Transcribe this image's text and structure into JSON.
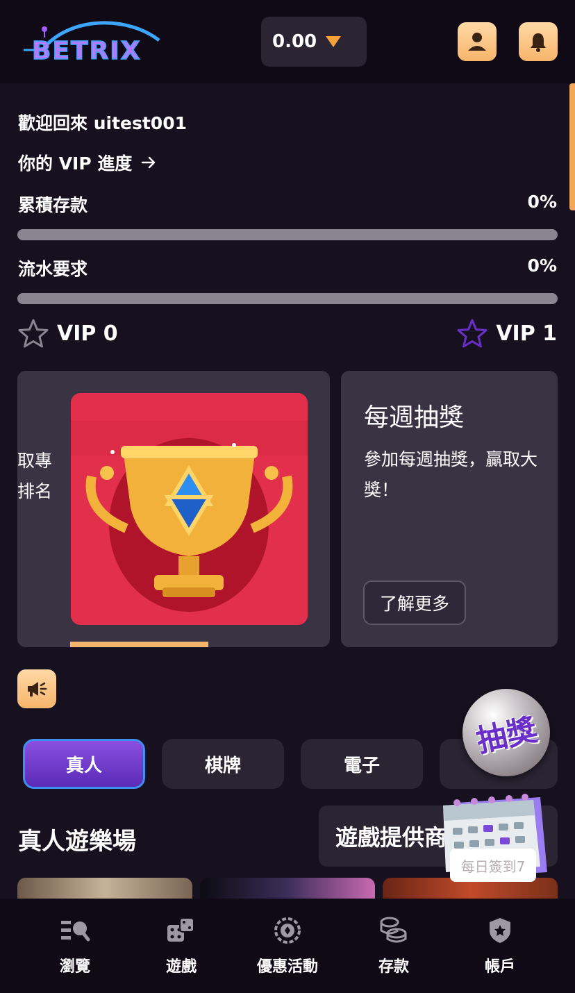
{
  "header": {
    "logo_text": "BETRIX",
    "balance": "0.00",
    "user_icon": "user-icon",
    "bell_icon": "bell-icon"
  },
  "welcome": {
    "greeting": "歡迎回來 uitest001",
    "vip_progress_link": "你的 VIP 進度"
  },
  "progress": {
    "deposit_label": "累積存款",
    "deposit_pct": "0%",
    "deposit_value": 0,
    "turnover_label": "流水要求",
    "turnover_pct": "0%",
    "turnover_value": 0
  },
  "vip": {
    "current": "VIP 0",
    "next": "VIP 1",
    "current_star_color": "#8a8590",
    "next_star_color": "#6a2fc9"
  },
  "promos": {
    "card_a_text_line1": "取專",
    "card_a_text_line2": "排名",
    "card_b_title": "每週抽獎",
    "card_b_desc": "參加每週抽獎，贏取大獎！",
    "card_b_button": "了解更多"
  },
  "categories": {
    "tabs": [
      "真人",
      "棋牌",
      "電子",
      ""
    ],
    "active_index": 0
  },
  "section": {
    "title": "真人遊樂場",
    "provider_button": "遊戲提供商"
  },
  "floating": {
    "lottery_label": "抽獎",
    "checkin_label": "每日簽到7"
  },
  "nav": {
    "items": [
      {
        "label": "瀏覽",
        "icon": "browse-icon"
      },
      {
        "label": "遊戲",
        "icon": "dice-icon"
      },
      {
        "label": "優惠活動",
        "icon": "promotion-icon"
      },
      {
        "label": "存款",
        "icon": "coins-icon"
      },
      {
        "label": "帳戶",
        "icon": "shield-star-icon"
      }
    ]
  },
  "colors": {
    "accent": "#f7b56b",
    "purple": "#6a2fc9",
    "background": "#17111f"
  }
}
